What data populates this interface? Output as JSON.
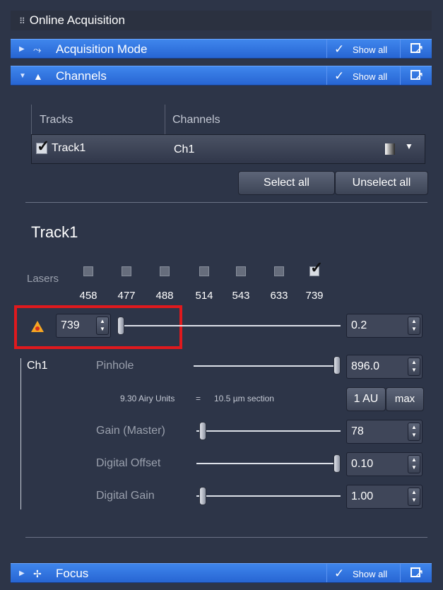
{
  "panel": {
    "title": "Online Acquisition"
  },
  "sections": {
    "acquisition_mode": {
      "label": "Acquisition Mode",
      "show_all": "Show all"
    },
    "channels": {
      "label": "Channels",
      "show_all": "Show all"
    },
    "focus": {
      "label": "Focus",
      "show_all": "Show all"
    }
  },
  "channels_table": {
    "headers": {
      "tracks": "Tracks",
      "channels": "Channels"
    },
    "row": {
      "track": "Track1",
      "track_checked": true,
      "channel": "Ch1"
    }
  },
  "buttons": {
    "select_all": "Select all",
    "unselect_all": "Unselect all"
  },
  "track": {
    "title": "Track1",
    "lasers_label": "Lasers",
    "lasers": [
      {
        "wavelength": "458",
        "checked": false
      },
      {
        "wavelength": "477",
        "checked": false
      },
      {
        "wavelength": "488",
        "checked": false
      },
      {
        "wavelength": "514",
        "checked": false
      },
      {
        "wavelength": "543",
        "checked": false
      },
      {
        "wavelength": "633",
        "checked": false
      },
      {
        "wavelength": "739",
        "checked": true
      }
    ],
    "active_laser": {
      "wavelength": "739",
      "power_value": "0.2",
      "power_level": 0.0
    },
    "channel_name": "Ch1",
    "pinhole": {
      "label": "Pinhole",
      "value": "896.0",
      "level": 1.0,
      "airy_units": "9.30 Airy Units",
      "equals": "=",
      "section": "10.5 µm section",
      "btn_1au": "1 AU",
      "btn_max": "max"
    },
    "gain_master": {
      "label": "Gain (Master)",
      "value": "78",
      "level": 0.0
    },
    "digital_offset": {
      "label": "Digital Offset",
      "value": "0.10",
      "level": 1.0
    },
    "digital_gain": {
      "label": "Digital Gain",
      "value": "1.00",
      "level": 0.0
    }
  },
  "colors": {
    "section_blue": "#2f6fe0",
    "panel_bg": "#2d3548",
    "highlight_red": "#e0191d",
    "warning": "#f6a623"
  }
}
